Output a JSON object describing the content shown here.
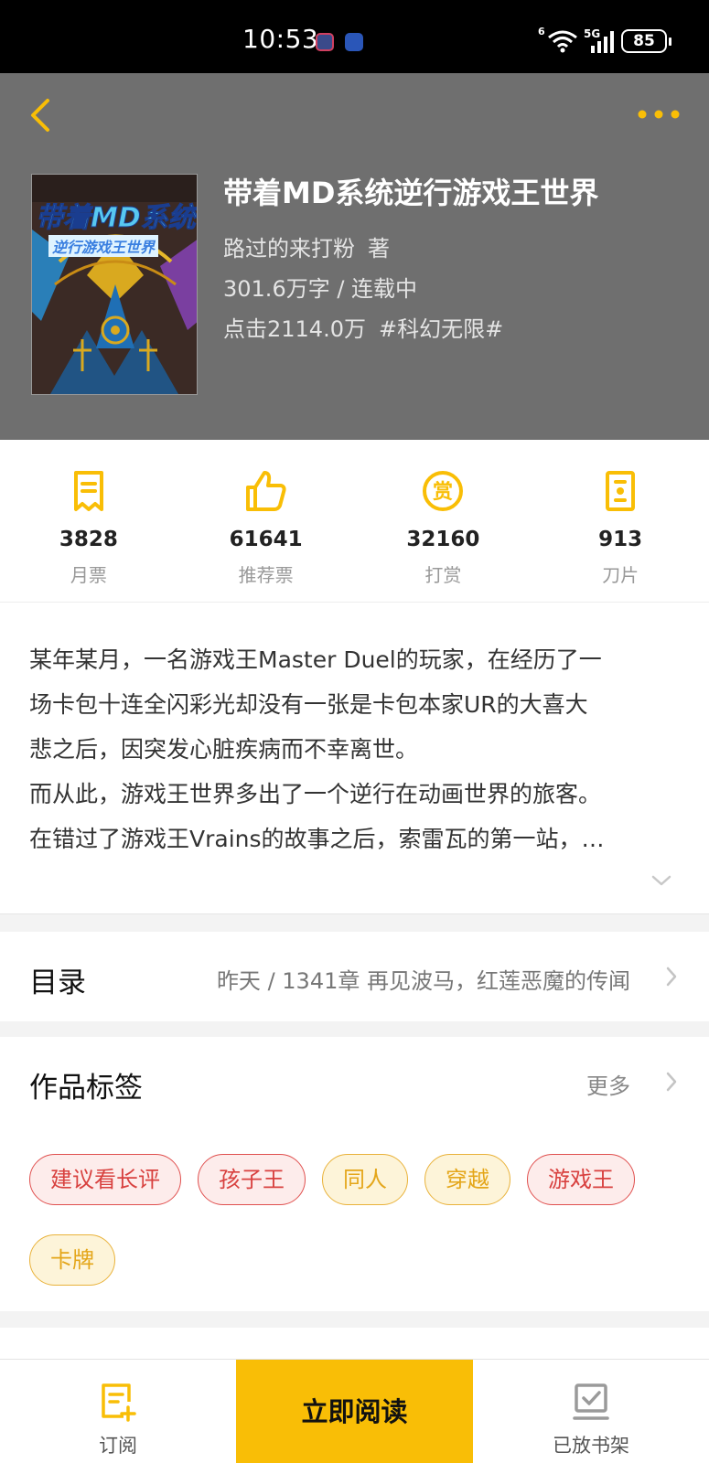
{
  "status_bar": {
    "time": "10:53",
    "battery": "85",
    "network": "5G",
    "signal_label": "6"
  },
  "header": {
    "back_icon": "chevron-left-icon",
    "more_icon": "more-dots-icon",
    "accent_color": "#f9be06",
    "background_color": "#6f6f6f"
  },
  "book": {
    "title": "带着MD系统逆行游戏王世界",
    "author": "路过的来打粉",
    "author_suffix": "著",
    "words_status": "301.6万字 / 连载中",
    "clicks": "点击2114.0万",
    "category": "#科幻无限#",
    "cover_title_line1": "带着MD系统",
    "cover_title_line2": "逆行游戏王世界"
  },
  "stats": [
    {
      "icon": "monthly-ticket-icon",
      "value": "3828",
      "label": "月票"
    },
    {
      "icon": "thumbs-up-icon",
      "value": "61641",
      "label": "推荐票"
    },
    {
      "icon": "reward-coin-icon",
      "value": "32160",
      "label": "打赏"
    },
    {
      "icon": "blade-card-icon",
      "value": "913",
      "label": "刀片"
    }
  ],
  "synopsis": {
    "lines": [
      "某年某月，一名游戏王Master Duel的玩家，在经历了一",
      "场卡包十连全闪彩光却没有一张是卡包本家UR的大喜大",
      "悲之后，因突发心脏疾病而不幸离世。",
      "而从此，游戏王世界多出了一个逆行在动画世界的旅客。",
      "在错过了游戏王Vrains的故事之后，索雷瓦的第一站，…"
    ]
  },
  "catalog": {
    "title": "目录",
    "latest": "昨天 / 1341章 再见波马，红莲恶魔的传闻"
  },
  "tags": {
    "title": "作品标签",
    "more": "更多",
    "items": [
      {
        "label": "建议看长评",
        "color": "red"
      },
      {
        "label": "孩子王",
        "color": "red"
      },
      {
        "label": "同人",
        "color": "yellow"
      },
      {
        "label": "穿越",
        "color": "yellow"
      },
      {
        "label": "游戏王",
        "color": "red"
      },
      {
        "label": "卡牌",
        "color": "yellow"
      }
    ]
  },
  "bottom_bar": {
    "subscribe": "订阅",
    "read_now": "立即阅读",
    "on_shelf": "已放书架"
  }
}
